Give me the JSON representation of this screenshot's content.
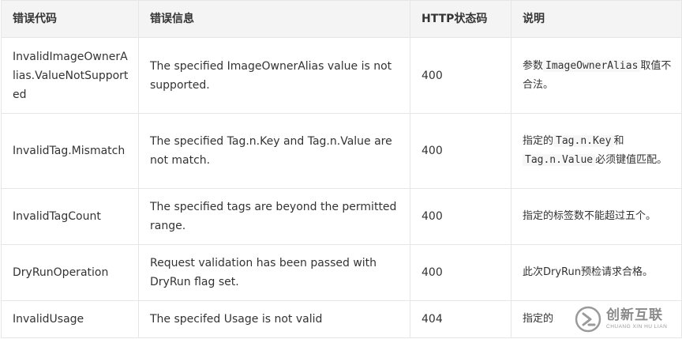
{
  "table": {
    "headers": [
      "错误代码",
      "错误信息",
      "HTTP状态码",
      "说明"
    ],
    "rows": [
      {
        "code": "InvalidImageOwnerAlias.ValueNotSupported",
        "message": "The specified ImageOwnerAlias value is not supported.",
        "http": "400",
        "desc_pre": "参数",
        "desc_code": "ImageOwnerAlias",
        "desc_post": "取值不合法。"
      },
      {
        "code": "InvalidTag.Mismatch",
        "message": "The specified Tag.n.Key and Tag.n.Value are not match.",
        "http": "400",
        "desc_pre": "指定的",
        "desc_code": "Tag.n.Key",
        "desc_mid": "和",
        "desc_code2": "Tag.n.Value",
        "desc_post": "必须键值匹配。"
      },
      {
        "code": "InvalidTagCount",
        "message": "The specified tags are beyond the permitted range.",
        "http": "400",
        "desc": "指定的标签数不能超过五个。"
      },
      {
        "code": "DryRunOperation",
        "message": "Request validation has been passed with DryRun flag set.",
        "http": "400",
        "desc": "此次DryRun预检请求合格。"
      },
      {
        "code": "InvalidUsage",
        "message": "The specifed Usage is not valid",
        "http": "404",
        "desc": "指定的"
      }
    ]
  },
  "watermark": {
    "name_cn": "创新互联",
    "name_en": "CHUANG XIN HU LIAN",
    "icon": "chuangxin-logo-icon"
  }
}
